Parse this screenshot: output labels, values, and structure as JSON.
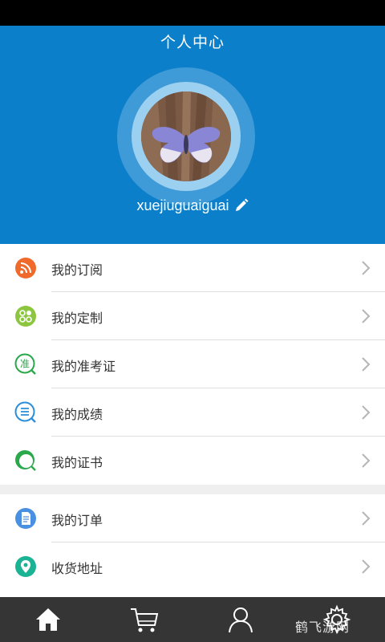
{
  "header": {
    "title": "个人中心",
    "username": "xuejiuguaiguai"
  },
  "menu_group_1": [
    {
      "label": "我的订阅",
      "icon": "rss-icon",
      "color": "#f06a2b"
    },
    {
      "label": "我的定制",
      "icon": "grid-dots-icon",
      "color": "#8cc63f"
    },
    {
      "label": "我的准考证",
      "icon": "admission-ticket-icon",
      "color": "#2aa84a"
    },
    {
      "label": "我的成绩",
      "icon": "score-list-icon",
      "color": "#2b8ed8"
    },
    {
      "label": "我的证书",
      "icon": "certificate-icon",
      "color": "#2aa84a"
    }
  ],
  "menu_group_2": [
    {
      "label": "我的订单",
      "icon": "order-document-icon",
      "color": "#4a90e2"
    },
    {
      "label": "收货地址",
      "icon": "location-pin-icon",
      "color": "#1ab394"
    }
  ],
  "icon_text": {
    "admission": "准"
  },
  "tab_bar": [
    {
      "name": "home",
      "icon": "home-icon",
      "active": true
    },
    {
      "name": "cart",
      "icon": "cart-icon",
      "active": false
    },
    {
      "name": "profile",
      "icon": "user-icon",
      "active": false
    },
    {
      "name": "settings",
      "icon": "gear-icon",
      "active": false
    }
  ],
  "watermark": "鹤飞游网",
  "colors": {
    "header_bg": "#0b7fca",
    "tab_bar_bg": "#353535",
    "divider": "#dedede",
    "section_gap": "#efefef"
  }
}
